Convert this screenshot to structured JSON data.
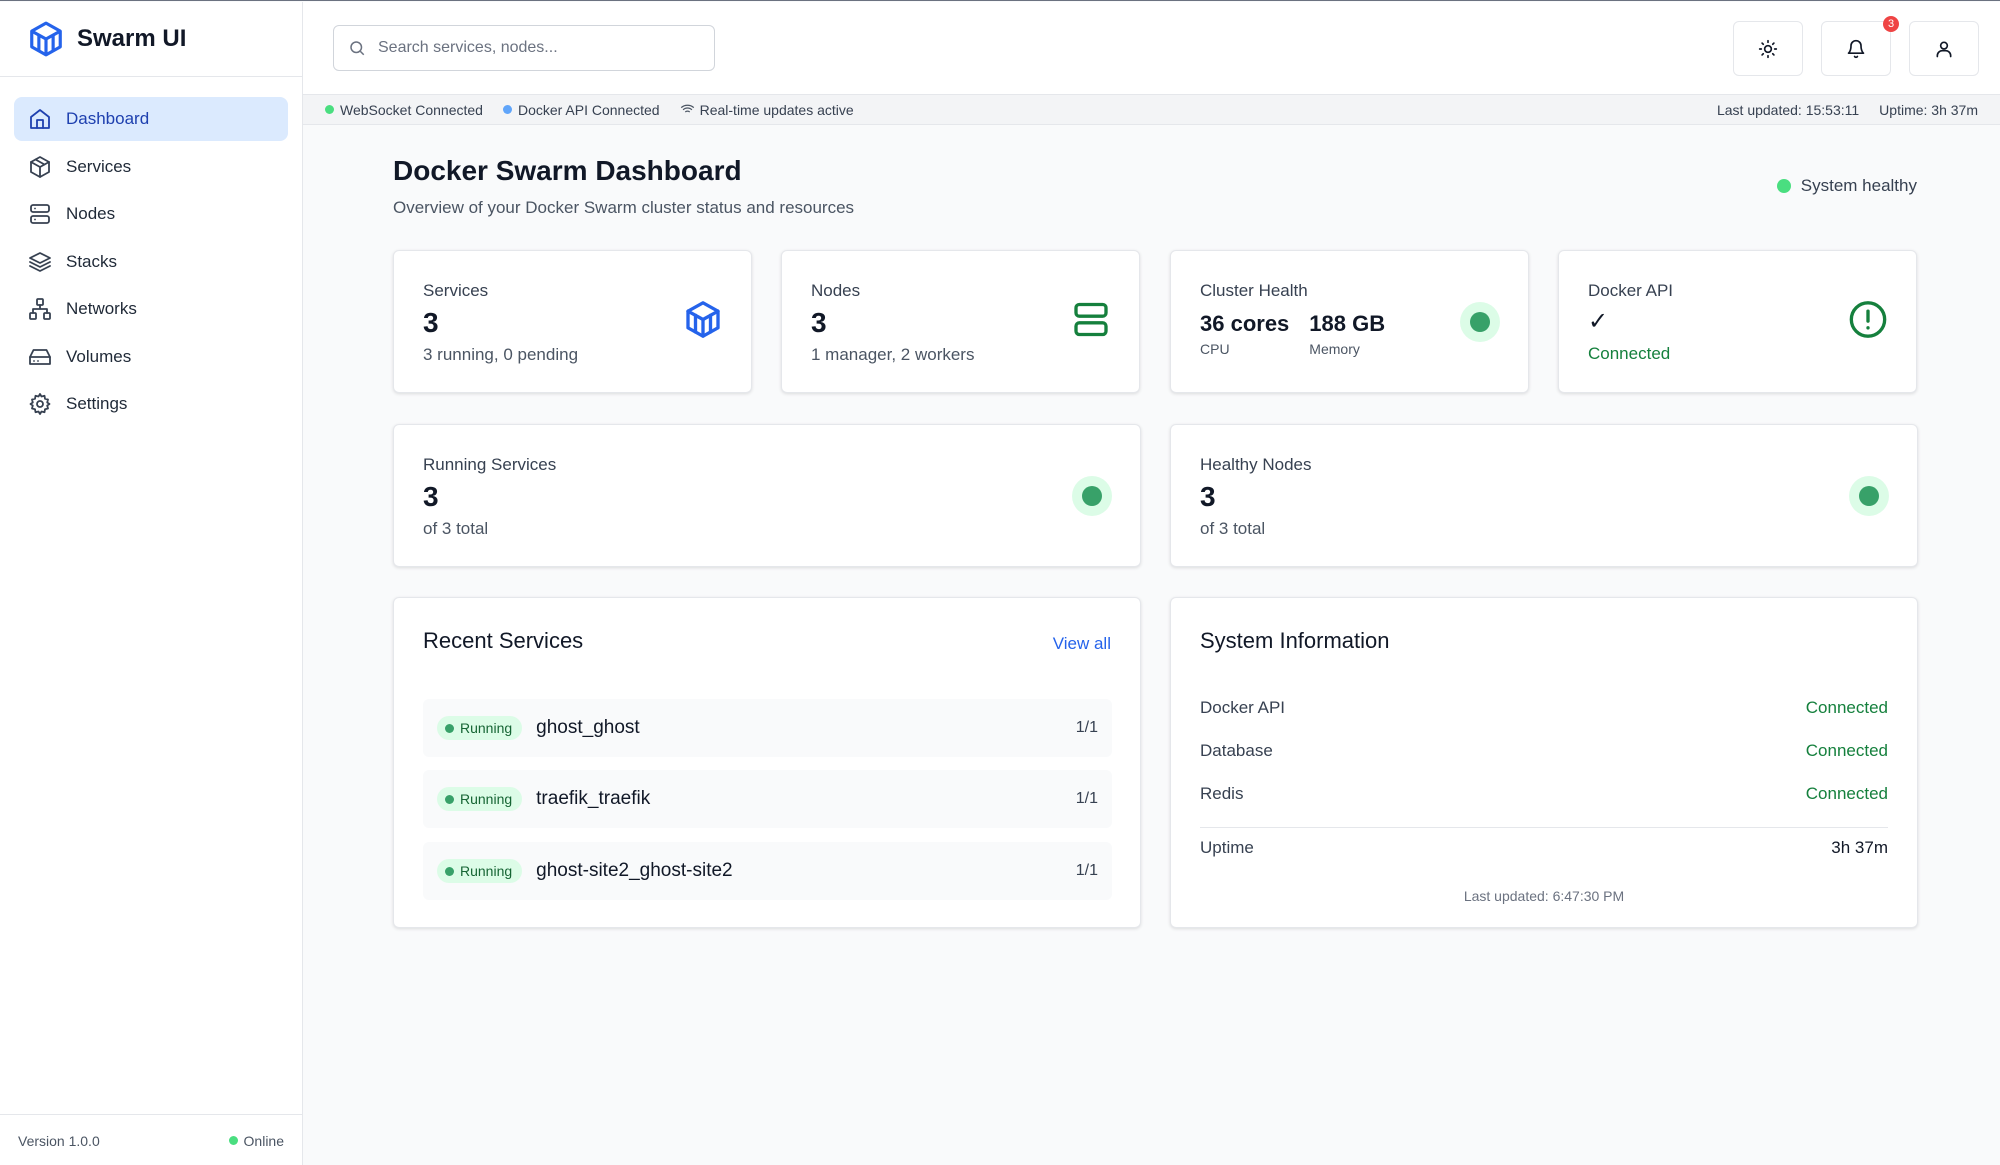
{
  "app": {
    "name": "Swarm UI",
    "version": "Version 1.0.0",
    "online": "Online"
  },
  "sidebar": {
    "items": [
      {
        "label": "Dashboard",
        "icon": "home-icon",
        "active": true
      },
      {
        "label": "Services",
        "icon": "box-icon"
      },
      {
        "label": "Nodes",
        "icon": "server-icon"
      },
      {
        "label": "Stacks",
        "icon": "layers-icon"
      },
      {
        "label": "Networks",
        "icon": "network-icon"
      },
      {
        "label": "Volumes",
        "icon": "hard-drive-icon"
      },
      {
        "label": "Settings",
        "icon": "gear-icon"
      }
    ]
  },
  "header": {
    "search_placeholder": "Search services, nodes...",
    "notification_count": "3"
  },
  "statusbar": {
    "websocket": "WebSocket Connected",
    "docker_api": "Docker API Connected",
    "realtime": "Real-time updates active",
    "last_updated": "Last updated: 15:53:11",
    "uptime": "Uptime: 3h 37m"
  },
  "page": {
    "title": "Docker Swarm Dashboard",
    "subtitle": "Overview of your Docker Swarm cluster status and resources",
    "system_status": "System healthy"
  },
  "stats": {
    "services": {
      "label": "Services",
      "value": "3",
      "sub": "3 running, 0 pending"
    },
    "nodes": {
      "label": "Nodes",
      "value": "3",
      "sub": "1 manager, 2 workers"
    },
    "cluster": {
      "label": "Cluster Health",
      "cpu_value": "36 cores",
      "cpu_label": "CPU",
      "mem_value": "188 GB",
      "mem_label": "Memory"
    },
    "docker": {
      "label": "Docker API",
      "check": "✓",
      "status": "Connected"
    }
  },
  "running": {
    "label": "Running Services",
    "value": "3",
    "sub": "of 3 total"
  },
  "healthy": {
    "label": "Healthy Nodes",
    "value": "3",
    "sub": "of 3 total"
  },
  "recent": {
    "title": "Recent Services",
    "view_all": "View all",
    "items": [
      {
        "status": "Running",
        "name": "ghost_ghost",
        "replicas": "1/1"
      },
      {
        "status": "Running",
        "name": "traefik_traefik",
        "replicas": "1/1"
      },
      {
        "status": "Running",
        "name": "ghost-site2_ghost-site2",
        "replicas": "1/1"
      }
    ]
  },
  "sysinfo": {
    "title": "System Information",
    "rows": [
      {
        "label": "Docker API",
        "value": "Connected"
      },
      {
        "label": "Database",
        "value": "Connected"
      },
      {
        "label": "Redis",
        "value": "Connected"
      }
    ],
    "uptime_label": "Uptime",
    "uptime_value": "3h 37m",
    "last_updated": "Last updated: 6:47:30 PM"
  },
  "colors": {
    "accent": "#2563eb",
    "success": "#38a169",
    "active_bg": "#dbeafe"
  }
}
